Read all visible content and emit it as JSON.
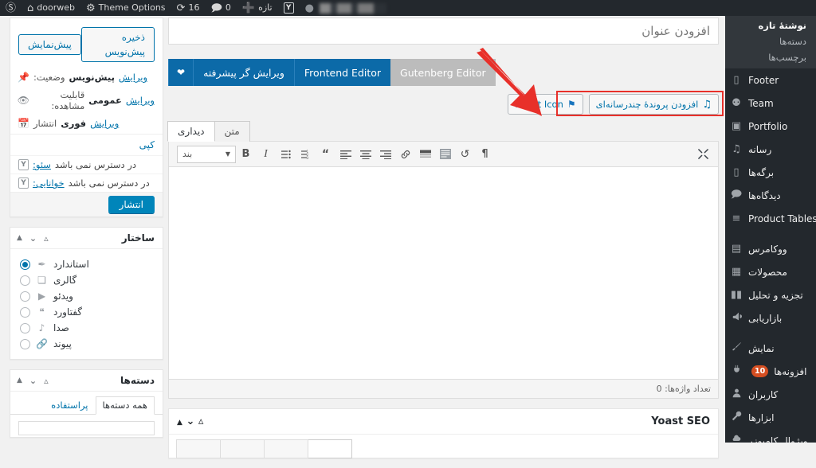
{
  "adminbar": {
    "wp_logo": "wordpress-logo",
    "site_name": "doorweb",
    "theme_options": "Theme Options",
    "updates_count": "16",
    "comments_count": "0",
    "new_label": "تازه",
    "yoast_label": "Y"
  },
  "sidebar": {
    "submenu": [
      {
        "label": "نوشتهٔ تازه",
        "active": true
      },
      {
        "label": "دسته‌ها",
        "active": false
      },
      {
        "label": "برچسب‌ها",
        "active": false
      }
    ],
    "items": [
      {
        "label": "Footer",
        "icon": "book-icon",
        "glyph": "▯",
        "badge": ""
      },
      {
        "label": "Team",
        "icon": "groups-icon",
        "glyph": "⚉",
        "badge": ""
      },
      {
        "label": "Portfolio",
        "icon": "portfolio-icon",
        "glyph": "▣",
        "badge": ""
      },
      {
        "label": "رسانه",
        "icon": "media-icon",
        "glyph": "♫",
        "badge": ""
      },
      {
        "label": "برگه‌ها",
        "icon": "pages-icon",
        "glyph": "▯",
        "badge": ""
      },
      {
        "label": "دیدگاه‌ها",
        "icon": "comment-icon",
        "glyph": "🗩",
        "badge": ""
      },
      {
        "label": "Product Tables",
        "icon": "table-icon",
        "glyph": "≡",
        "badge": ""
      },
      {
        "label": "ووکامرس",
        "icon": "woocommerce-icon",
        "glyph": "▤",
        "badge": ""
      },
      {
        "label": "محصولات",
        "icon": "products-icon",
        "glyph": "▦",
        "badge": ""
      },
      {
        "label": "تجزیه و تحلیل",
        "icon": "analytics-icon",
        "glyph": "▮▮",
        "badge": ""
      },
      {
        "label": "بازاریابی",
        "icon": "megaphone-icon",
        "glyph": "📣",
        "badge": ""
      },
      {
        "label": "نمایش",
        "icon": "appearance-brush-icon",
        "glyph": "✎",
        "badge": ""
      },
      {
        "label": "افزونه‌ها",
        "icon": "plugins-icon",
        "glyph": "⚯",
        "badge": "10"
      },
      {
        "label": "کاربران",
        "icon": "users-icon",
        "glyph": "👤",
        "badge": ""
      },
      {
        "label": "ابزارها",
        "icon": "tools-icon",
        "glyph": "🛠",
        "badge": ""
      },
      {
        "label": "ویژوال کامپوزر",
        "icon": "visual-composer-icon",
        "glyph": "⬣",
        "badge": ""
      }
    ]
  },
  "publish_box": {
    "save_draft": "ذخیره پیش‌نویس",
    "preview": "پیش‌نمایش",
    "status_label": "وضعیت:",
    "status_value": "پیش‌نویس",
    "status_edit": "ویرایش",
    "visibility_label": "قابلیت مشاهده:",
    "visibility_value": "عمومی",
    "visibility_edit": "ویرایش",
    "publish_label": "انتشار",
    "publish_value": "فوری",
    "publish_edit": "ویرایش",
    "copy_link": "کپی",
    "seo_label": "سئو:",
    "seo_value": "در دسترس نمی باشد",
    "readability_label": "خوانایی:",
    "readability_value": "در دسترس نمی باشد",
    "publish_button": "انتشار"
  },
  "format_box": {
    "title": "ساختار",
    "options": [
      {
        "label": "استاندارد",
        "icon": "pin-icon",
        "glyph": "✒",
        "selected": true
      },
      {
        "label": "گالری",
        "icon": "gallery-icon",
        "glyph": "❏",
        "selected": false
      },
      {
        "label": "ویدئو",
        "icon": "video-icon",
        "glyph": "▶",
        "selected": false
      },
      {
        "label": "گفتاورد",
        "icon": "quote-icon",
        "glyph": "❝",
        "selected": false
      },
      {
        "label": "صدا",
        "icon": "audio-icon",
        "glyph": "♪",
        "selected": false
      },
      {
        "label": "پیوند",
        "icon": "link-icon",
        "glyph": "🔗",
        "selected": false
      }
    ]
  },
  "categories_box": {
    "title": "دسته‌ها",
    "tab_all": "همه دسته‌ها",
    "tab_most_used": "پراستفاده"
  },
  "editor": {
    "title_placeholder": "افزودن عنوان",
    "buttons": [
      {
        "label": "Gutenberg Editor",
        "style": "gray",
        "name": "gutenberg-editor-button"
      },
      {
        "label": "Frontend Editor",
        "style": "blue",
        "name": "frontend-editor-button"
      },
      {
        "label": "ویرایش گر پیشرفته",
        "style": "blue",
        "name": "advanced-editor-button"
      }
    ],
    "heart_icon": "heart-icon",
    "media_button": "افزودن پروندهٔ چندرسانه‌ای",
    "insert_icon_button": "Insert Icon",
    "tab_visual": "دیداری",
    "tab_text": "متن",
    "paragraph_select": "بند",
    "word_count": "تعداد واژه‌ها: 0",
    "toolbar": [
      {
        "name": "bold-icon",
        "glyph": "B"
      },
      {
        "name": "italic-icon",
        "glyph": "I"
      },
      {
        "name": "bulleted-list-icon",
        "glyph": "☰"
      },
      {
        "name": "numbered-list-icon",
        "glyph": "☷"
      },
      {
        "name": "blockquote-icon",
        "glyph": "❝"
      },
      {
        "name": "align-right-icon",
        "glyph": "≡"
      },
      {
        "name": "align-center-icon",
        "glyph": "≡"
      },
      {
        "name": "align-left-icon",
        "glyph": "≡"
      },
      {
        "name": "link-icon",
        "glyph": "🔗"
      },
      {
        "name": "read-more-icon",
        "glyph": "▤"
      },
      {
        "name": "kitchen-sink-icon",
        "glyph": "▥"
      },
      {
        "name": "undo-icon",
        "glyph": "↺"
      },
      {
        "name": "rtl-icon",
        "glyph": "¶"
      }
    ],
    "fullscreen_icon": "fullscreen-icon"
  },
  "yoast_box": {
    "title": "Yoast SEO"
  },
  "colors": {
    "admin_dark": "#23282d",
    "admin_submenu": "#32373c",
    "wp_blue": "#0073aa",
    "button_blue": "#0c6aa8",
    "badge_red": "#d54e21",
    "annotation_red": "#e8302a"
  }
}
